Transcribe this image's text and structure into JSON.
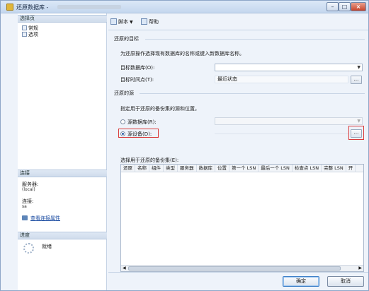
{
  "window": {
    "title": "还原数据库 -"
  },
  "left": {
    "select_page_header": "选择页",
    "pages": [
      {
        "label": "常规"
      },
      {
        "label": "选项"
      }
    ],
    "connection_header": "连接",
    "server_label": "服务器:",
    "server_value": "(local)",
    "connection_label": "连接:",
    "connection_value": "sa",
    "view_connection_link": "查看连接属性",
    "progress_header": "进度",
    "progress_status": "就绪"
  },
  "toolbar": {
    "script_label": "脚本",
    "help_label": "帮助"
  },
  "restore_target": {
    "group_label": "还原的目标",
    "instruction": "为还原操作选择现有数据库的名称或键入新数据库名称。",
    "target_db_label": "目标数据库(O):",
    "target_db_value": "",
    "target_time_label": "目标时间点(T):",
    "target_time_value": "最近状态",
    "browse_label": "..."
  },
  "restore_source": {
    "group_label": "还原的源",
    "instruction": "指定用于还原的备份集的源和位置。",
    "source_db_label": "源数据库(R):",
    "source_device_label": "源设备(D):",
    "browse_label": "...",
    "selected_option": "source_device"
  },
  "backup_sets": {
    "label": "选择用于还原的备份集(E):",
    "columns": [
      "还原",
      "名称",
      "组件",
      "类型",
      "服务器",
      "数据库",
      "位置",
      "第一个 LSN",
      "最后一个 LSN",
      "检查点 LSN",
      "完整 LSN",
      "开"
    ]
  },
  "footer": {
    "ok_label": "确定",
    "cancel_label": "取消"
  }
}
